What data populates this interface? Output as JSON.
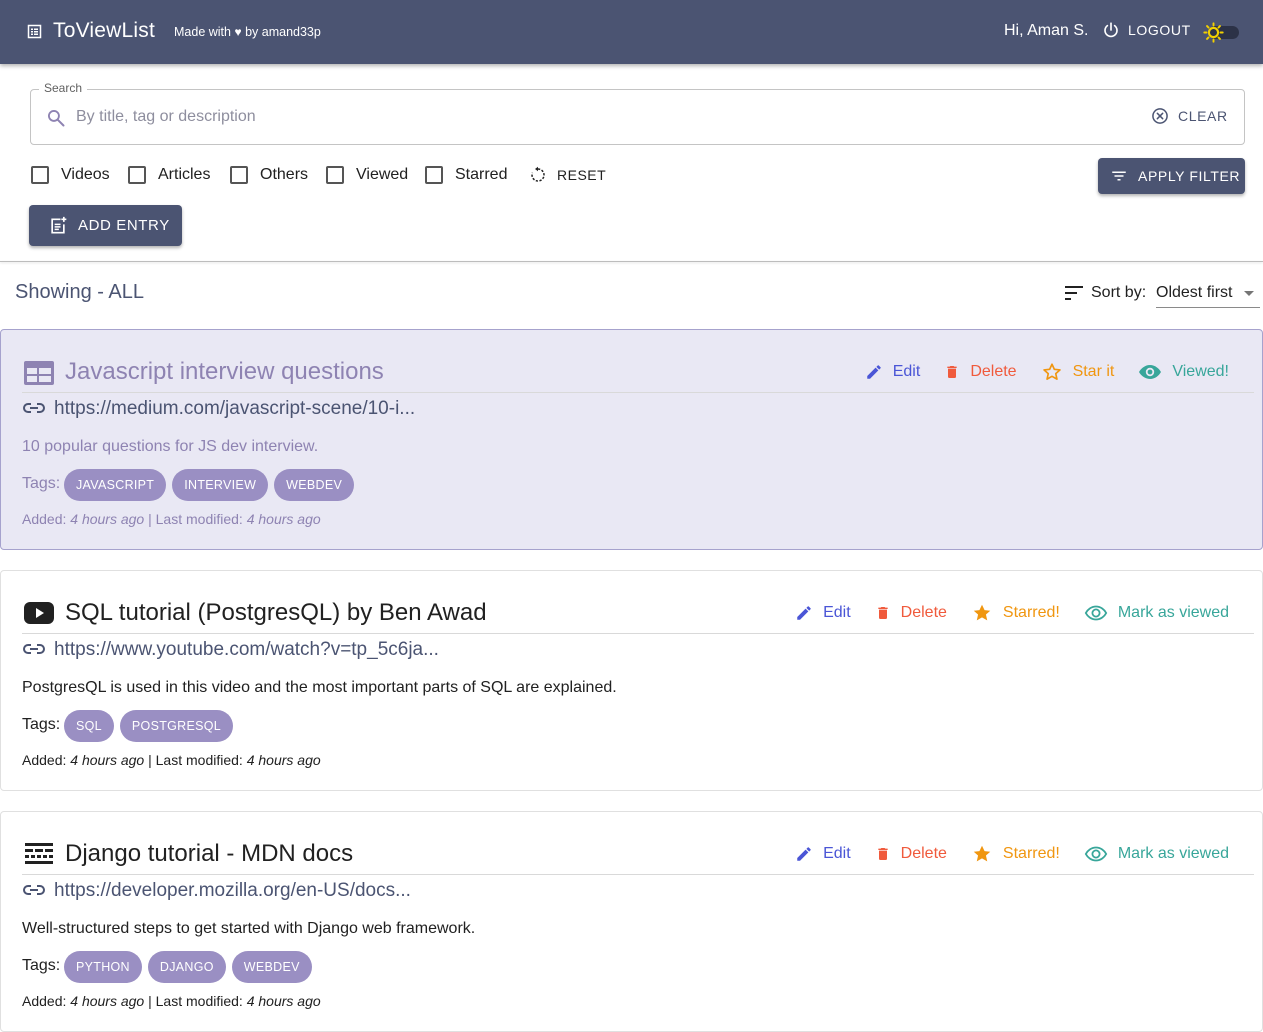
{
  "appbar": {
    "brand": "ToViewList",
    "made_with_prefix": "Made with",
    "made_with_heart": "♥",
    "made_with_suffix": "by amand33p",
    "greeting": "Hi, Aman S.",
    "logout_label": "LOGOUT",
    "colors": {
      "background": "#4b5472",
      "sun": "#f2d000"
    }
  },
  "search": {
    "legend": "Search",
    "placeholder": "By title, tag or description",
    "value": "",
    "clear_label": "CLEAR"
  },
  "filters": {
    "items": [
      {
        "label": "Videos",
        "checked": false
      },
      {
        "label": "Articles",
        "checked": false
      },
      {
        "label": "Others",
        "checked": false
      },
      {
        "label": "Viewed",
        "checked": false
      },
      {
        "label": "Starred",
        "checked": false
      }
    ],
    "reset_label": "RESET",
    "apply_label": "APPLY FILTER"
  },
  "add_entry_label": "ADD ENTRY",
  "showing_label": "Showing - ALL",
  "sort": {
    "label": "Sort by:",
    "selected": "Oldest first"
  },
  "entries": [
    {
      "type_icon": "article-icon",
      "title": "Javascript interview questions",
      "url": "https://medium.com/javascript-scene/10-i...",
      "description": "10 popular questions for JS dev interview.",
      "tags_label": "Tags:",
      "tags": [
        "JAVASCRIPT",
        "INTERVIEW",
        "WEBDEV"
      ],
      "edit_label": "Edit",
      "delete_label": "Delete",
      "star_label": "Star it",
      "starred": false,
      "view_label": "Viewed!",
      "viewed": true,
      "added_label": "Added:",
      "added": "4 hours ago",
      "separator": "|",
      "modified_label": "Last modified:",
      "modified": "4 hours ago"
    },
    {
      "type_icon": "youtube-icon",
      "title": "SQL tutorial (PostgresQL) by Ben Awad",
      "url": "https://www.youtube.com/watch?v=tp_5c6ja...",
      "description": "PostgresQL is used in this video and the most important parts of SQL are explained.",
      "tags_label": "Tags:",
      "tags": [
        "SQL",
        "POSTGRESQL"
      ],
      "edit_label": "Edit",
      "delete_label": "Delete",
      "star_label": "Starred!",
      "starred": true,
      "view_label": "Mark as viewed",
      "viewed": false,
      "added_label": "Added:",
      "added": "4 hours ago",
      "separator": "|",
      "modified_label": "Last modified:",
      "modified": "4 hours ago"
    },
    {
      "type_icon": "web-asset-icon",
      "title": "Django tutorial - MDN docs",
      "url": "https://developer.mozilla.org/en-US/docs...",
      "description": "Well-structured steps to get started with Django web framework.",
      "tags_label": "Tags:",
      "tags": [
        "PYTHON",
        "DJANGO",
        "WEBDEV"
      ],
      "edit_label": "Edit",
      "delete_label": "Delete",
      "star_label": "Starred!",
      "starred": true,
      "view_label": "Mark as viewed",
      "viewed": false,
      "added_label": "Added:",
      "added": "4 hours ago",
      "separator": "|",
      "modified_label": "Last modified:",
      "modified": "4 hours ago"
    }
  ]
}
